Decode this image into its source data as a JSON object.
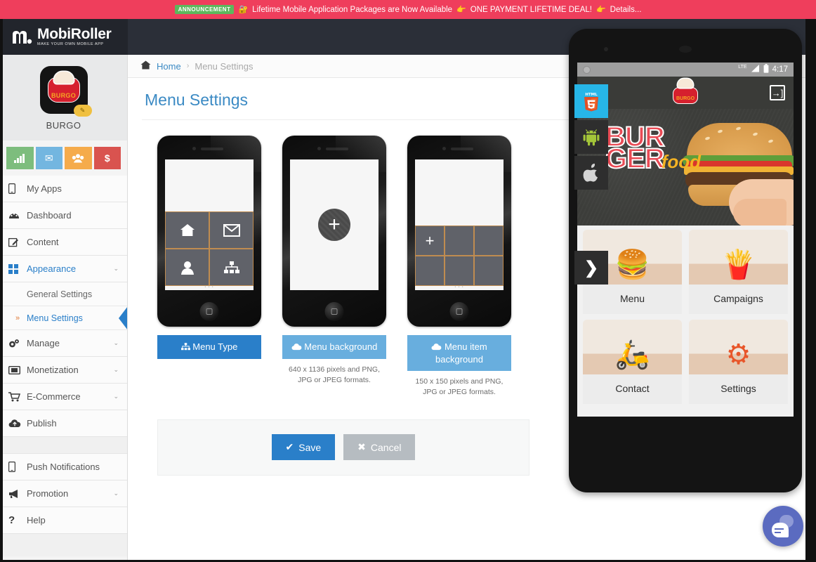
{
  "announcement": {
    "badge": "ANNOUNCEMENT",
    "lock_icon": "lock-icon",
    "text": "Lifetime Mobile Application Packages are Now Available",
    "hand_icon_1": "pointing-hand-icon",
    "deal_text": "ONE PAYMENT LIFETIME DEAL!",
    "hand_icon_2": "pointing-hand-icon",
    "details_link": "Details...",
    "bg_color": "#ef3e5c",
    "badge_color": "#5cb85c"
  },
  "brand": {
    "name": "MobiRoller",
    "tagline": "MAKE YOUR OWN MOBILE APP",
    "logo_icon": "mobiroller-logo-icon"
  },
  "sidebar": {
    "app": {
      "name": "BURGO",
      "logo_word": "BURGO",
      "logo_icon": "burgo-app-logo",
      "edit_icon": "pencil-icon"
    },
    "quick_actions": [
      {
        "name": "statistics",
        "icon": "bar-chart-icon",
        "color": "#7dbd7d"
      },
      {
        "name": "messages",
        "icon": "envelope-icon",
        "color": "#73b6e0"
      },
      {
        "name": "users",
        "icon": "users-icon",
        "color": "#f5ab4b"
      },
      {
        "name": "billing",
        "icon": "dollar-icon",
        "color": "#d9534f"
      }
    ],
    "items": [
      {
        "label": "My Apps",
        "icon": "mobile-icon",
        "caret": "",
        "active": false
      },
      {
        "label": "Dashboard",
        "icon": "dashboard-icon",
        "caret": "",
        "active": false
      },
      {
        "label": "Content",
        "icon": "edit-square-icon",
        "caret": "",
        "active": false
      },
      {
        "label": "Appearance",
        "icon": "grid-icon",
        "caret": "⌄",
        "active": true
      }
    ],
    "sub_items": [
      {
        "label": "General Settings",
        "selected": false
      },
      {
        "label": "Menu Settings",
        "selected": true,
        "bullet": "»"
      }
    ],
    "items2": [
      {
        "label": "Manage",
        "icon": "gears-icon",
        "caret": "⌄"
      },
      {
        "label": "Monetization",
        "icon": "money-icon",
        "caret": "⌄"
      },
      {
        "label": "E-Commerce",
        "icon": "cart-icon",
        "caret": "⌄"
      },
      {
        "label": "Publish",
        "icon": "cloud-upload-icon",
        "caret": ""
      }
    ],
    "items3": [
      {
        "label": "Push Notifications",
        "icon": "mobile-icon",
        "caret": ""
      },
      {
        "label": "Promotion",
        "icon": "megaphone-icon",
        "caret": "⌄"
      },
      {
        "label": "Help",
        "icon": "question-icon",
        "caret": ""
      }
    ]
  },
  "breadcrumb": {
    "home_icon": "home-icon",
    "home": "Home",
    "separator": "›",
    "current": "Menu Settings"
  },
  "page": {
    "title": "Menu Settings"
  },
  "cards": [
    {
      "button_label": "Menu Type",
      "button_icon": "sitemap-icon",
      "button_style": "primary",
      "note": "",
      "preview": "grid-2x2"
    },
    {
      "button_label": "Menu background",
      "button_icon": "cloud-icon",
      "button_style": "light",
      "note": "640 x 1136 pixels and PNG, JPG or JPEG formats.",
      "preview": "upload-plus"
    },
    {
      "button_label": "Menu item background",
      "button_icon": "cloud-icon",
      "button_style": "light",
      "note": "150 x 150 pixels and PNG, JPG or JPEG formats.",
      "preview": "grid-3x2"
    }
  ],
  "actions": {
    "save_label": "Save",
    "save_icon": "check-icon",
    "cancel_label": "Cancel",
    "cancel_icon": "times-icon",
    "save_color": "#2a7fc9",
    "cancel_color": "#b6bcc1"
  },
  "preview": {
    "platforms": [
      {
        "name": "html5",
        "icon": "html5-icon",
        "active": true
      },
      {
        "name": "android",
        "icon": "android-icon",
        "active": false
      },
      {
        "name": "ios",
        "icon": "apple-icon",
        "active": false
      }
    ],
    "collapse_icon": "chevron-right-icon",
    "status_bar": {
      "network": "LTE",
      "signal_icon": "signal-icon",
      "battery_icon": "battery-icon",
      "time": "4:17"
    },
    "appbar": {
      "logo_word": "BURGO",
      "exit_icon": "exit-icon"
    },
    "hero": {
      "hash": "#",
      "line1": "BUR",
      "line2": "GER",
      "line3": "food",
      "image": "hand-holding-burger"
    },
    "menu_items": [
      {
        "label": "Menu",
        "icon": "🍔"
      },
      {
        "label": "Campaigns",
        "icon": "🍟"
      },
      {
        "label": "Contact",
        "icon": "🛵"
      },
      {
        "label": "Settings",
        "icon": "⚙"
      }
    ],
    "nav": {
      "back_icon": "back-triangle-icon",
      "home_icon": "home-circle-icon",
      "recents_icon": "recents-square-icon"
    }
  },
  "chat": {
    "icon": "chat-bubbles-icon",
    "color": "#5b6bc0"
  }
}
